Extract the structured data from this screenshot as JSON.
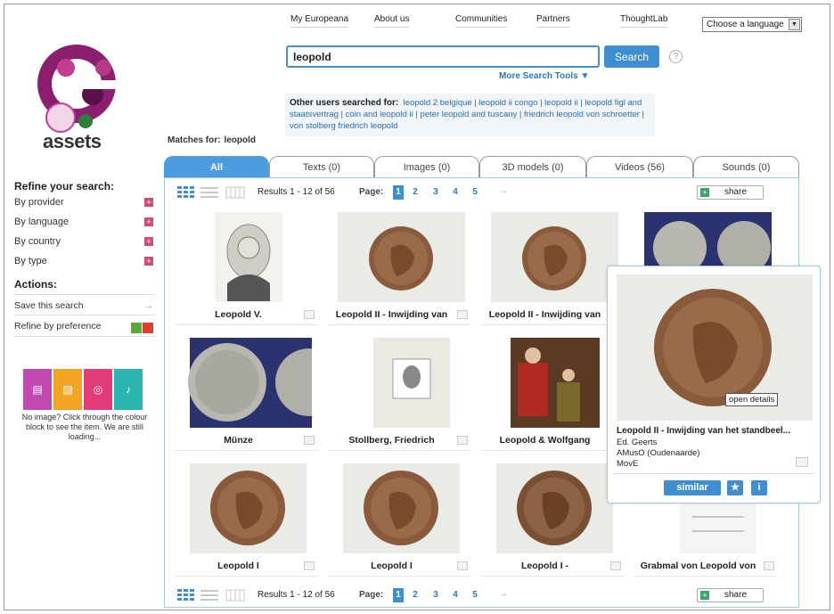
{
  "nav": {
    "items": [
      "My Europeana",
      "About us",
      "Communities",
      "Partners",
      "ThoughtLab"
    ],
    "language_select": "Choose a language"
  },
  "search": {
    "query": "leopold",
    "button": "Search",
    "help": "?",
    "more_tools": "More Search Tools ▼"
  },
  "other_searches": {
    "label": "Other users searched for:",
    "text": "leopold 2 belgique | leopold ii congo | leopold ii | leopold figl and staatsvertrag | coin and leopold ii | peter leopold and tuscany | friedrich leopold von schroetter | von stolberg friedrich leopold"
  },
  "matches": {
    "label": "Matches for:",
    "term": "leopold"
  },
  "logo": {
    "text": "assets"
  },
  "sidebar": {
    "refine_title": "Refine your search:",
    "refine_items": [
      "By provider",
      "By language",
      "By country",
      "By type"
    ],
    "actions_title": "Actions:",
    "save_search": "Save this search",
    "refine_pref": "Refine by preference",
    "noimage_text": "No image? Click through the colour block to see the item. We are still loading..."
  },
  "tabs": [
    "All",
    "Texts (0)",
    "Images (0)",
    "3D models (0)",
    "Videos (56)",
    "Sounds (0)"
  ],
  "toolbar": {
    "results": "Results 1 - 12 of 56",
    "page_label": "Page:",
    "pages": [
      "1",
      "2",
      "3",
      "4",
      "5"
    ],
    "next": "→",
    "share": "share"
  },
  "items": [
    {
      "title": "Leopold V."
    },
    {
      "title": "Leopold II - Inwijding van"
    },
    {
      "title": "Leopold II - Inwijding van"
    },
    {
      "title": ""
    },
    {
      "title": "Münze"
    },
    {
      "title": "Stollberg, Friedrich"
    },
    {
      "title": "Leopold & Wolfgang"
    },
    {
      "title": ""
    },
    {
      "title": "Leopold I"
    },
    {
      "title": "Leopold I"
    },
    {
      "title": "Leopold I -"
    },
    {
      "title": "Grabmal von Leopold von"
    }
  ],
  "popup": {
    "tooltip": "open details",
    "title": "Leopold II - Inwijding van het standbeel...",
    "creator": "Ed. Geerts",
    "provider": "AMusO (Oudenaarde)",
    "source": "MovE",
    "similar": "similar",
    "star": "★",
    "info": "i"
  }
}
